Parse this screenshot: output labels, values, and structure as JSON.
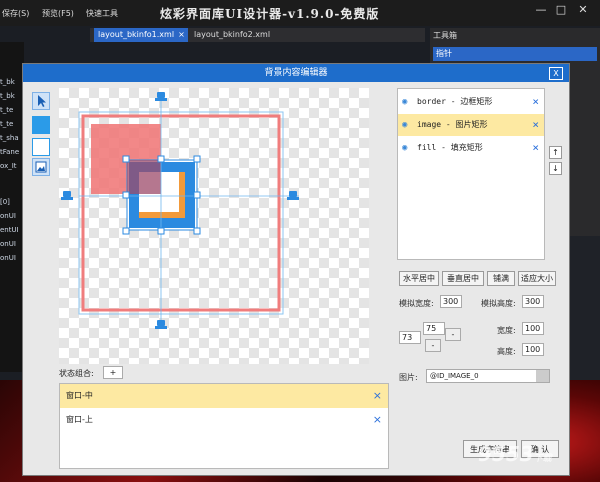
{
  "app": {
    "title": "炫彩界面库UI设计器-v1.9.0-免费版",
    "menu": [
      "保存(S)",
      "预览(F5)",
      "快速工具"
    ],
    "tabs": [
      {
        "label": "layout_bkinfo1.xml",
        "active": true,
        "close": "×"
      },
      {
        "label": "layout_bkinfo2.xml",
        "active": false
      }
    ],
    "toolbox_title": "工具箱",
    "toolbox_selected": "指针",
    "left_items": [
      "t_bk",
      "t_bk",
      "t_te",
      "t_te",
      "t_sha",
      "tFane",
      "ox_It",
      "[0]",
      "onUI",
      "entUI",
      "onUI",
      "onUI"
    ],
    "window_buttons": {
      "minimize": "—",
      "maximize": "□",
      "close": "✕"
    }
  },
  "dialog": {
    "title": "背景内容编辑器",
    "close": "X",
    "tools": [
      "pointer-tool",
      "fill-rect-tool",
      "border-rect-tool",
      "image-tool"
    ],
    "layers": [
      {
        "label": "border - 边框矩形",
        "selected": false
      },
      {
        "label": "image - 图片矩形",
        "selected": true
      },
      {
        "label": "fill - 填充矩形",
        "selected": false
      }
    ],
    "layer_close": "×",
    "move_up": "↑",
    "move_down": "↓",
    "align_buttons": [
      "水平居中",
      "垂直居中",
      "铺满",
      "适应大小"
    ],
    "sim_width_label": "模拟宽度:",
    "sim_width_value": "300",
    "sim_height_label": "模拟高度:",
    "sim_height_value": "300",
    "pos_x": "73",
    "pos_y": "75",
    "minus": "-",
    "width_label": "宽度:",
    "width_value": "100",
    "height_label": "高度:",
    "height_value": "100",
    "image_label": "图片:",
    "image_value": "@ID_IMAGE_0",
    "states_label": "状态组合:",
    "states_add": "+",
    "states": [
      {
        "label": "窗口-中",
        "selected": true
      },
      {
        "label": "窗口-上",
        "selected": false
      }
    ],
    "generate_button": "生成字符串",
    "confirm_button": "确 认"
  },
  "watermark": {
    "main": "9553",
    "sub": "下载"
  },
  "colors": {
    "accent": "#1e6dcb",
    "selected_row": "#fde9a2",
    "border_rect": "#f07d7d",
    "fill_rect": "#f07878",
    "image_frame": "#2b8ae0"
  }
}
